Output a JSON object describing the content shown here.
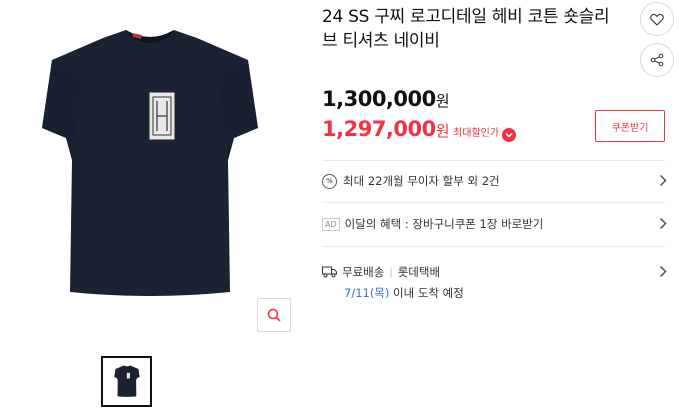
{
  "product": {
    "title": "24 SS 구찌 로고디테일 헤비 코튼 숏슬리브 티셔츠 네이비",
    "original_price": "1,300,000",
    "sale_price": "1,297,000",
    "currency_unit": "원",
    "sale_label": "최대할인가",
    "coupon_button": "쿠폰받기"
  },
  "benefits": {
    "installment_icon": "%",
    "installment": "최대 22개월 무이자 할부 외 2건",
    "ad_badge": "AD",
    "monthly_benefit": "이달의 혜택 : 장바구니쿠폰 1장 바로받기"
  },
  "delivery": {
    "label": "무료배송",
    "carrier": "롯데택배",
    "date": "7/11(목)",
    "date_suffix": "이내 도착 예정"
  },
  "colors": {
    "accent": "#f43142",
    "link_blue": "#3d6fd6",
    "shirt_navy": "#1a2233"
  },
  "icons": [
    "heart-icon",
    "share-icon",
    "zoom-icon",
    "chevron-right-icon",
    "truck-icon",
    "chevron-down-icon"
  ]
}
